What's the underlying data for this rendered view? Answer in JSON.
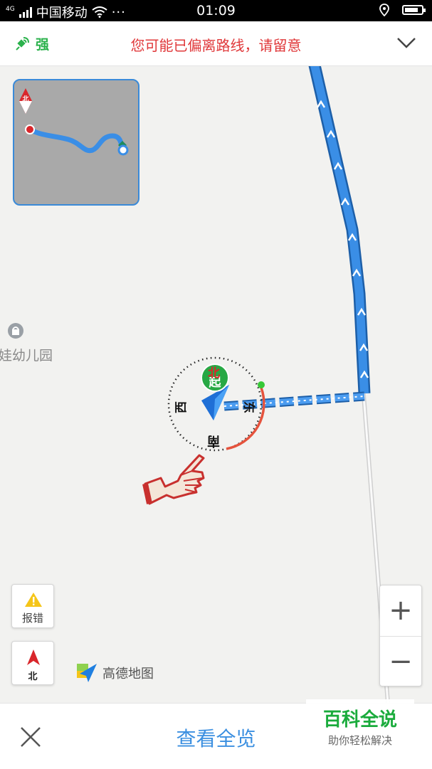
{
  "status_bar": {
    "carrier": "中国移动",
    "network": "4G",
    "time": "01:09",
    "battery_level": 0.8
  },
  "nav_warning": {
    "gps_label": "强",
    "message": "您可能已偏离路线，请留意"
  },
  "map": {
    "poi_label": "娃幼儿园",
    "minimap_north": "北",
    "compass": {
      "north": "北",
      "south": "南",
      "east": "东",
      "west": "西",
      "start": "起"
    },
    "report_label": "报错",
    "north_label": "北",
    "zoom_in": "+",
    "zoom_out": "−",
    "brand": "高德地图"
  },
  "bottom": {
    "overview_label": "查看全览"
  },
  "watermark": {
    "title": "百科全说",
    "subtitle": "助你轻松解决"
  },
  "colors": {
    "route": "#3a8ee6",
    "warning": "#e0383a",
    "gps": "#2bb24c",
    "overview": "#3b8fe0"
  }
}
